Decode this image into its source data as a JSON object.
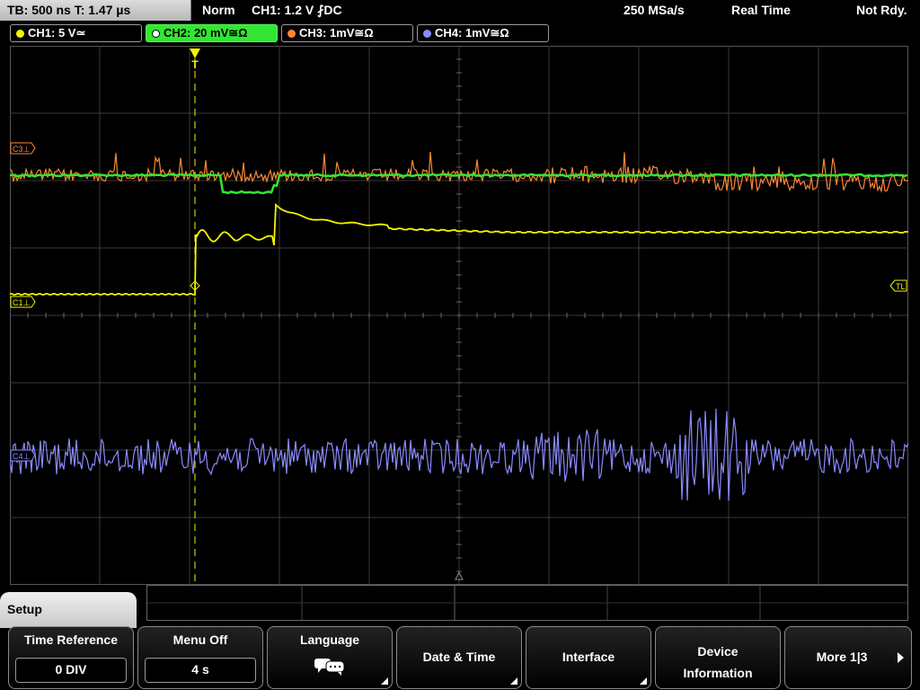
{
  "status": {
    "timebase": "TB: 500 ns  T: 1.47 µs",
    "trigger_mode": "Norm",
    "trigger_info": "CH1: 1.2 V ⨏DC",
    "sample_rate": "250 MSa/s",
    "acq_mode": "Real Time",
    "state": "Not Rdy."
  },
  "channels": [
    {
      "label": "CH1: 5 V≃",
      "color": "#f5f500"
    },
    {
      "label": "CH2: 20 mV≅Ω",
      "color": "#33e633"
    },
    {
      "label": "CH3: 1mV≅Ω",
      "color": "#ff8833"
    },
    {
      "label": "CH4: 1mV≅Ω",
      "color": "#8a8aff"
    }
  ],
  "markers": {
    "c3": "C3⊥",
    "c1": "C1⊥",
    "c4": "C4⊥",
    "tl": "TL",
    "trigger": "T"
  },
  "menu": {
    "title": "Setup",
    "time_reference": {
      "label": "Time Reference",
      "value": "0 DIV"
    },
    "menu_off": {
      "label": "Menu Off",
      "value": "4 s"
    },
    "language": {
      "label": "Language"
    },
    "date_time": {
      "label": "Date & Time"
    },
    "interface": {
      "label": "Interface"
    },
    "device_info": {
      "label_line1": "Device",
      "label_line2": "Information"
    },
    "more": {
      "label": "More 1|3"
    }
  }
}
